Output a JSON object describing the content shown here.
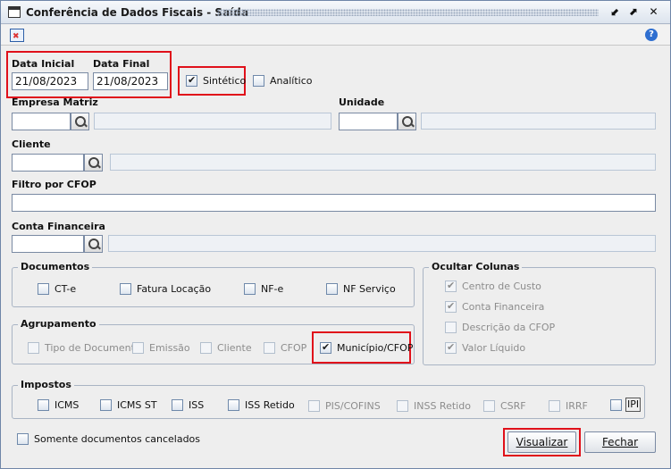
{
  "window": {
    "title": "Conferência de Dados Fiscais - Saída"
  },
  "titlebar_buttons": {
    "restore": "⬋",
    "maximize": "⬈",
    "close": "✕"
  },
  "toolbar": {
    "left_icon": "export-icon",
    "help_icon": "help-icon",
    "help_glyph": "?"
  },
  "dates": {
    "start_label": "Data Inicial",
    "start_value": "21/08/2023",
    "end_label": "Data Final",
    "end_value": "21/08/2023"
  },
  "report_type": {
    "sintetico": "Sintético",
    "analitico": "Analítico"
  },
  "empresa": {
    "label": "Empresa Matriz"
  },
  "unidade": {
    "label": "Unidade"
  },
  "cliente": {
    "label": "Cliente"
  },
  "cfop": {
    "label": "Filtro por CFOP"
  },
  "conta": {
    "label": "Conta Financeira"
  },
  "documentos": {
    "label": "Documentos",
    "items": [
      "CT-e",
      "Fatura Locação",
      "NF-e",
      "NF Serviço"
    ]
  },
  "ocultar": {
    "label": "Ocultar Colunas",
    "items": [
      "Centro de Custo",
      "Conta Financeira",
      "Descrição da CFOP",
      "Valor Líquido"
    ]
  },
  "agrupamento": {
    "label": "Agrupamento",
    "items": [
      "Tipo de Documento",
      "Emissão",
      "Cliente",
      "CFOP",
      "Município/CFOP"
    ]
  },
  "impostos": {
    "label": "Impostos",
    "items": [
      "ICMS",
      "ICMS ST",
      "ISS",
      "ISS Retido",
      "PIS/COFINS",
      "INSS Retido",
      "CSRF",
      "IRRF",
      "IPI"
    ]
  },
  "cancelados": {
    "label": "Somente documentos cancelados"
  },
  "buttons": {
    "visualizar": "Visualizar",
    "fechar": "Fechar"
  },
  "colors": {
    "highlight": "#e0101a"
  }
}
